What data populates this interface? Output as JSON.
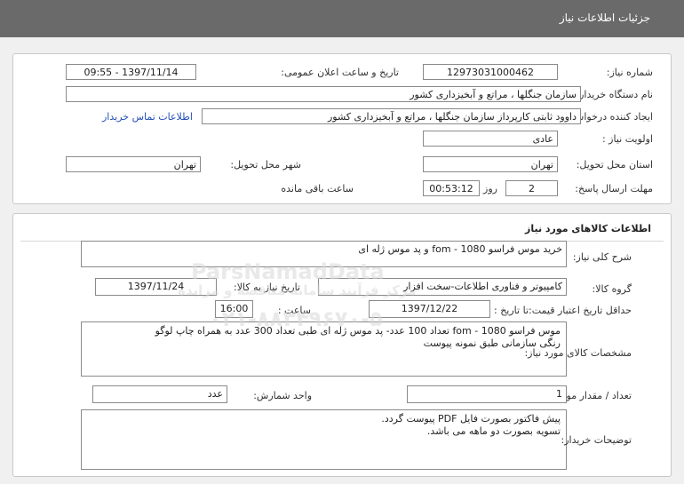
{
  "header": {
    "title": "جزئیات اطلاعات نیاز"
  },
  "need_info": {
    "need_number_label": "شماره نیاز:",
    "need_number": "12973031000462",
    "announce_datetime_label": "تاریخ و ساعت اعلان عمومی:",
    "announce_datetime": "1397/11/14 - 09:55",
    "buyer_org_label": "نام دستگاه خریدار:",
    "buyer_org": "سازمان جنگلها ، مراتع و آبخیزداری کشور",
    "requester_label": "ایجاد کننده درخواست:",
    "requester": "داوود  ثابتی کارپرداز سازمان جنگلها ، مراتع و آبخیزداری کشور",
    "contact_link": "اطلاعات تماس خریدار",
    "priority_label": "اولویت نیاز :",
    "priority": "عادی",
    "delivery_province_label": "استان محل تحویل:",
    "delivery_province": "تهران",
    "delivery_city_label": "شهر محل تحویل:",
    "delivery_city": "تهران",
    "deadline_label": "مهلت ارسال پاسخ:",
    "deadline_days": "2",
    "days_unit": "روز و",
    "deadline_time": "00:53:12",
    "remaining_label": "ساعت باقی مانده"
  },
  "goods_info": {
    "section_title": "اطلاعات کالاهای مورد نیاز",
    "summary_label": "شرح کلی نیاز:",
    "summary": "خرید موس فراسو fom - 1080 و پد موس ژله ای",
    "goods_group_label": "گروه کالا:",
    "goods_group": "کامپیوتر و فناوری اطلاعات-سخت افزار",
    "need_date_label": "تاریخ نیاز به کالا:",
    "need_date": "1397/11/24",
    "validity_label": "حداقل تاریخ اعتبار قیمت:",
    "until_date_label": "تا تاریخ :",
    "until_date": "1397/12/22",
    "time_label": "ساعت :",
    "time": "16:00",
    "specs_label": "مشخصات کالای مورد نیاز:",
    "specs_line1": "موس فراسو fom - 1080 تعداد 100 عدد- پد موس ژله ای طبی تعداد 300 عدد به همراه چاپ لوگو",
    "specs_line2": "رنگی سازمانی طبق نمونه پیوست",
    "quantity_label": "تعداد / مقدار مورد نیاز:",
    "quantity": "1",
    "unit_label": "واحد شمارش:",
    "unit": "عدد",
    "buyer_notes_label": "توضیحات خریدار:",
    "buyer_notes_line1": "پیش فاکتور بصورت فایل PDF پیوست گردد.",
    "buyer_notes_line2": "تسویه بصورت دو ماهه می باشد."
  },
  "watermark": {
    "brand": "ParsNamadData",
    "tagline": "مرکز فرآیند سامانه مناقصه و مزایده",
    "phone": "۰۲۱-۸۸۳۴۹۶۷۰-۵"
  }
}
